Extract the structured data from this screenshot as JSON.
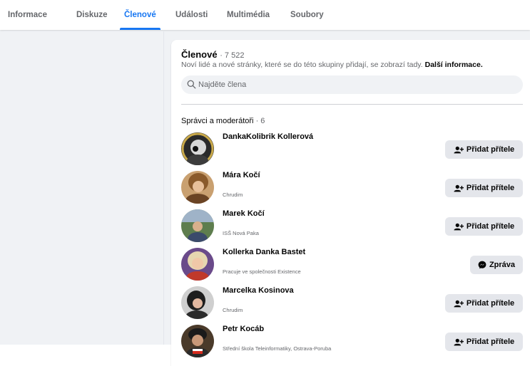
{
  "tabs": [
    {
      "label": "Informace",
      "active": false
    },
    {
      "label": "Diskuze",
      "active": false
    },
    {
      "label": "Členové",
      "active": true
    },
    {
      "label": "Události",
      "active": false
    },
    {
      "label": "Multimédia",
      "active": false
    },
    {
      "label": "Soubory",
      "active": false
    }
  ],
  "members_panel": {
    "title": "Členové",
    "count": "· 7 522",
    "subtitle": "Noví lidé a nové stránky, které se do této skupiny přidají, se zobrazí tady.",
    "more_link": "Další informace.",
    "search_placeholder": "Najděte člena",
    "section_title": "Správci a moderátoři",
    "section_count": "· 6",
    "add_friend_label": "Přidat přítele",
    "message_label": "Zpráva",
    "members": [
      {
        "name": "DankaKolibrik Kollerová",
        "subtitle": "",
        "action": "add"
      },
      {
        "name": "Mára Kočí",
        "subtitle": "Chrudim",
        "action": "add"
      },
      {
        "name": "Marek Kočí",
        "subtitle": "ISŠ Nová Paka",
        "action": "add"
      },
      {
        "name": "Kollerka Danka Bastet",
        "subtitle": "Pracuje ve společnosti Existence",
        "action": "message"
      },
      {
        "name": "Marcelka Kosinova",
        "subtitle": "Chrudim",
        "action": "add"
      },
      {
        "name": "Petr Kocáb",
        "subtitle": "Střední škola Teleinformatiky, Ostrava-Poruba",
        "action": "add"
      }
    ]
  },
  "colors": {
    "accent": "#1877f2",
    "page_bg": "#f0f2f5",
    "button_bg": "#e4e6eb",
    "secondary_text": "#65676b"
  },
  "icons": {
    "search": "search-icon",
    "add_friend": "add-friend-icon",
    "messenger": "messenger-icon"
  }
}
